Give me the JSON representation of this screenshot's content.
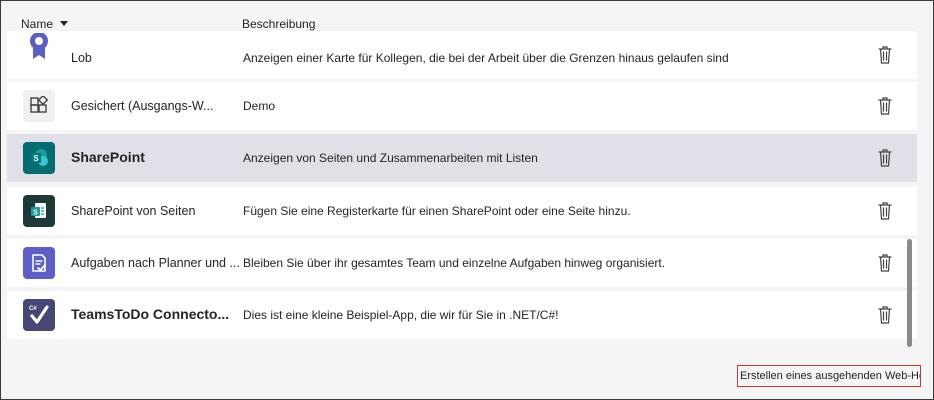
{
  "header": {
    "name_label": "Name",
    "description_label": "Beschreibung"
  },
  "apps": [
    {
      "name": "Lob",
      "description": "Anzeigen einer Karte für Kollegen, die bei der Arbeit über die Grenzen hinaus gelaufen sind",
      "icon": "award-icon"
    },
    {
      "name": "Gesichert (Ausgangs-W...",
      "description": "Demo",
      "icon": "apps-grid-icon"
    },
    {
      "name": "SharePoint",
      "description": "Anzeigen von Seiten und Zusammenarbeiten mit Listen",
      "icon": "sharepoint-icon"
    },
    {
      "name": "SharePoint von Seiten",
      "description": "Fügen Sie eine Registerkarte für einen SharePoint oder eine Seite hinzu.",
      "icon": "sharepoint-pages-icon"
    },
    {
      "name": "Aufgaben nach Planner und ...",
      "description": "Bleiben Sie über ihr gesamtes Team und einzelne Aufgaben hinweg organisiert.",
      "icon": "tasks-icon"
    },
    {
      "name": "TeamsToDo Connecto...",
      "description": "Dies ist eine kleine Beispiel-App, die wir für Sie in .NET/C#!",
      "icon": "checkmark-csharp-icon"
    }
  ],
  "footer": {
    "webhook_label": "Erstellen eines ausgehenden Web-Hooks"
  },
  "colors": {
    "selected_row": "#e1dfe8",
    "sharepoint": "#036c70",
    "planner": "#5b5fc7",
    "todo": "#464775",
    "highlight_border": "#d13438"
  }
}
